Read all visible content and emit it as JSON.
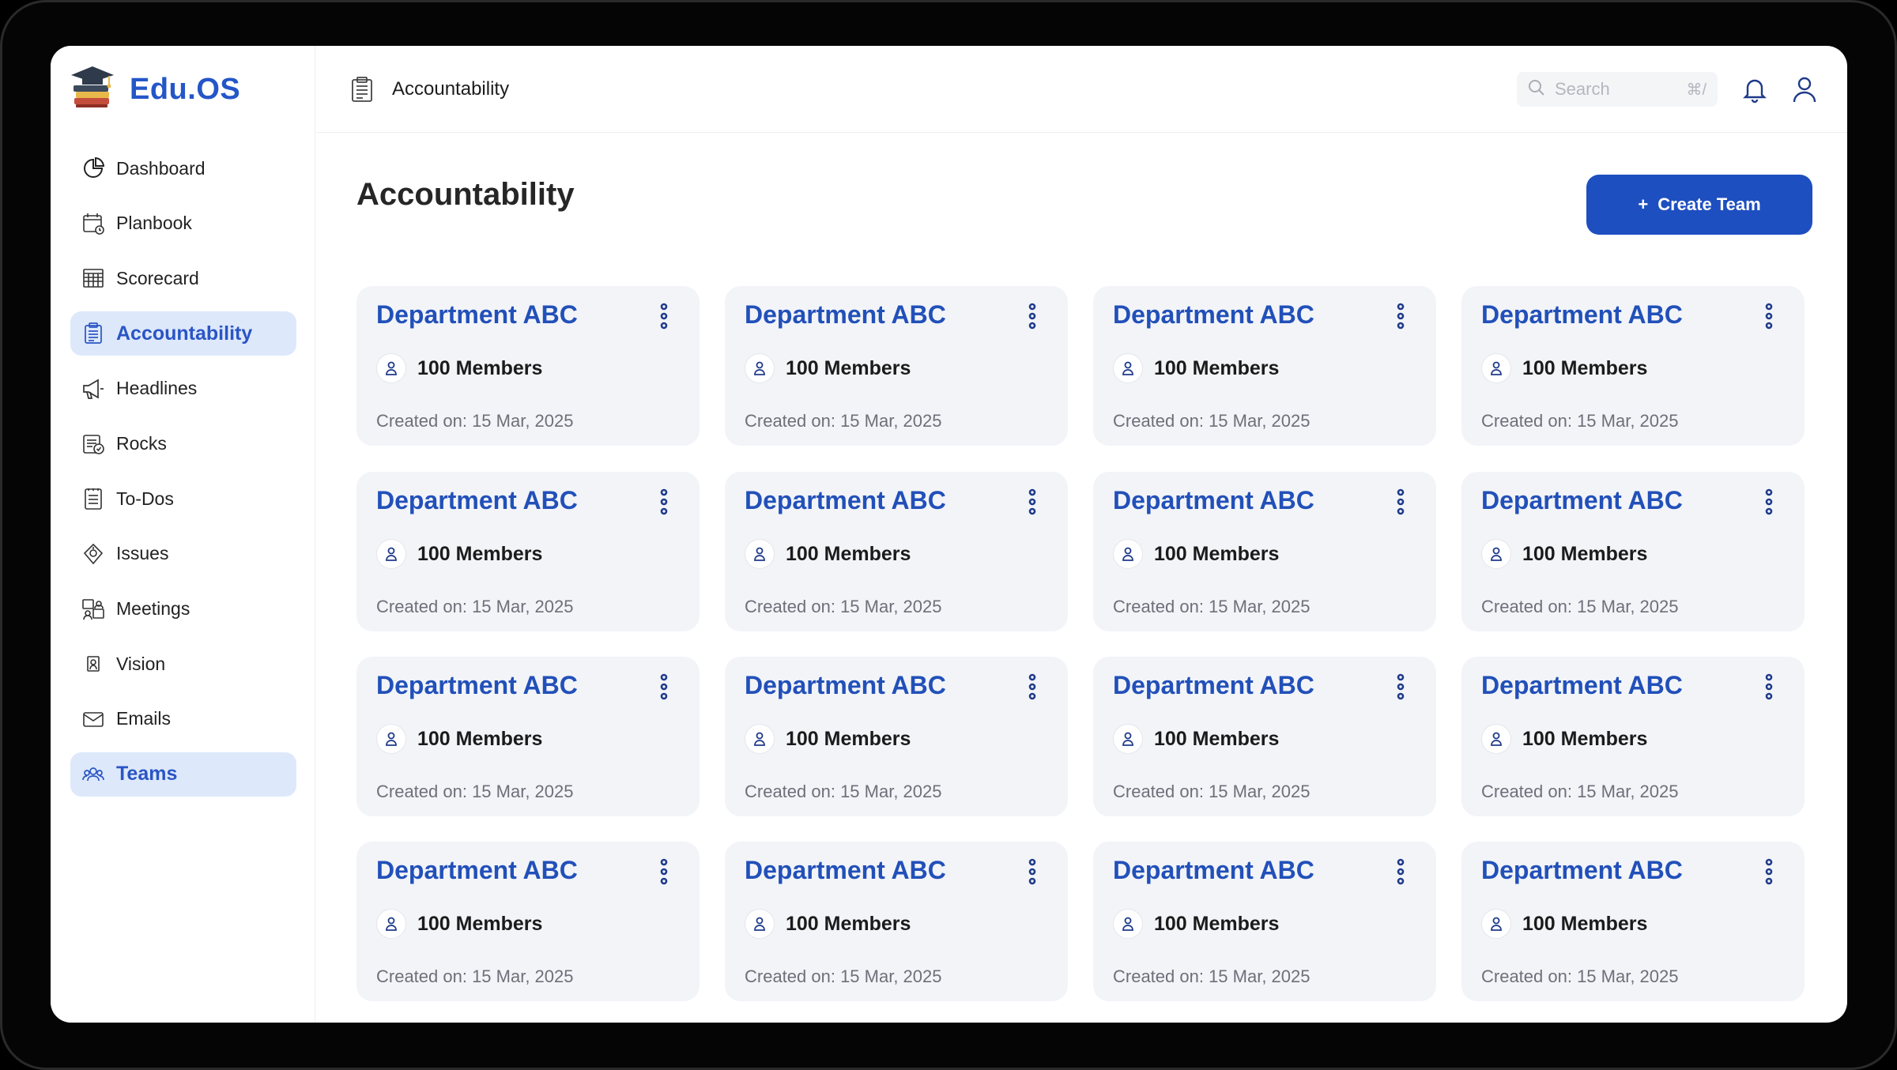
{
  "app": {
    "name": "Edu.OS"
  },
  "sidebar": {
    "items": [
      {
        "label": "Dashboard",
        "icon": "pie-chart-icon",
        "active": false
      },
      {
        "label": "Planbook",
        "icon": "calendar-icon",
        "active": false
      },
      {
        "label": "Scorecard",
        "icon": "scorecard-icon",
        "active": false
      },
      {
        "label": "Accountability",
        "icon": "clipboard-icon",
        "active": true
      },
      {
        "label": "Headlines",
        "icon": "megaphone-icon",
        "active": false
      },
      {
        "label": "Rocks",
        "icon": "rocks-icon",
        "active": false
      },
      {
        "label": "To-Dos",
        "icon": "checklist-icon",
        "active": false
      },
      {
        "label": "Issues",
        "icon": "issues-icon",
        "active": false
      },
      {
        "label": "Meetings",
        "icon": "meetings-icon",
        "active": false
      },
      {
        "label": "Vision",
        "icon": "vision-icon",
        "active": false
      },
      {
        "label": "Emails",
        "icon": "mail-icon",
        "active": false
      },
      {
        "label": "Teams",
        "icon": "team-icon",
        "active": true
      }
    ]
  },
  "header": {
    "breadcrumb": "Accountability",
    "search": {
      "placeholder": "Search",
      "shortcut": "⌘/"
    }
  },
  "main": {
    "title": "Accountability",
    "create_button": "Create Team",
    "cards": [
      {
        "title": "Department ABC",
        "members": "100 Members",
        "created": "Created on: 15 Mar, 2025"
      },
      {
        "title": "Department ABC",
        "members": "100 Members",
        "created": "Created on: 15 Mar, 2025"
      },
      {
        "title": "Department ABC",
        "members": "100 Members",
        "created": "Created on: 15 Mar, 2025"
      },
      {
        "title": "Department ABC",
        "members": "100 Members",
        "created": "Created on: 15 Mar, 2025"
      },
      {
        "title": "Department ABC",
        "members": "100 Members",
        "created": "Created on: 15 Mar, 2025"
      },
      {
        "title": "Department ABC",
        "members": "100 Members",
        "created": "Created on: 15 Mar, 2025"
      },
      {
        "title": "Department ABC",
        "members": "100 Members",
        "created": "Created on: 15 Mar, 2025"
      },
      {
        "title": "Department ABC",
        "members": "100 Members",
        "created": "Created on: 15 Mar, 2025"
      },
      {
        "title": "Department ABC",
        "members": "100 Members",
        "created": "Created on: 15 Mar, 2025"
      },
      {
        "title": "Department ABC",
        "members": "100 Members",
        "created": "Created on: 15 Mar, 2025"
      },
      {
        "title": "Department ABC",
        "members": "100 Members",
        "created": "Created on: 15 Mar, 2025"
      },
      {
        "title": "Department ABC",
        "members": "100 Members",
        "created": "Created on: 15 Mar, 2025"
      },
      {
        "title": "Department ABC",
        "members": "100 Members",
        "created": "Created on: 15 Mar, 2025"
      },
      {
        "title": "Department ABC",
        "members": "100 Members",
        "created": "Created on: 15 Mar, 2025"
      },
      {
        "title": "Department ABC",
        "members": "100 Members",
        "created": "Created on: 15 Mar, 2025"
      },
      {
        "title": "Department ABC",
        "members": "100 Members",
        "created": "Created on: 15 Mar, 2025"
      }
    ]
  },
  "colors": {
    "brand": "#2456c8",
    "button": "#1e4fc0",
    "active_bg": "#dde8fb",
    "card_bg": "#f2f4f8"
  }
}
